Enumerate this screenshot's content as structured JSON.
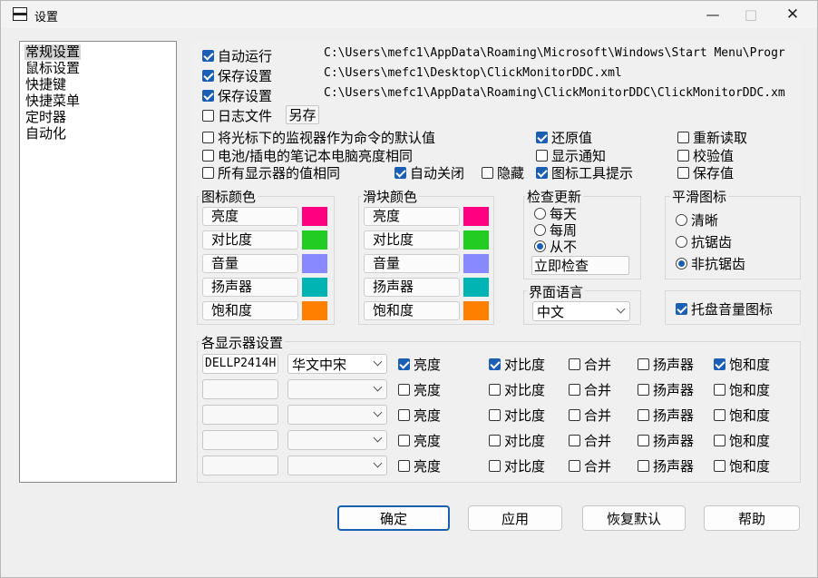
{
  "window": {
    "title": "设置"
  },
  "nav": {
    "items": [
      "常规设置",
      "鼠标设置",
      "快捷键",
      "快捷菜单",
      "定时器",
      "自动化"
    ],
    "selected": 0
  },
  "general": {
    "auto_run": {
      "label": "自动运行",
      "checked": true,
      "path": "C:\\Users\\mefc1\\AppData\\Roaming\\Microsoft\\Windows\\Start Menu\\Progr"
    },
    "save_settings1": {
      "label": "保存设置",
      "checked": true,
      "path": "C:\\Users\\mefc1\\Desktop\\ClickMonitorDDC.xml"
    },
    "save_settings2": {
      "label": "保存设置",
      "checked": true,
      "path": "C:\\Users\\mefc1\\AppData\\Roaming\\ClickMonitorDDC\\ClickMonitorDDC.xm"
    },
    "log_file": {
      "label": "日志文件",
      "checked": false,
      "save_as": "另存"
    }
  },
  "options": {
    "cursor_monitor_default": {
      "label": "将光标下的监视器作为命令的默认值",
      "checked": false
    },
    "battery_same": {
      "label": "电池/插电的笔记本电脑亮度相同",
      "checked": false
    },
    "all_same": {
      "label": "所有显示器的值相同",
      "checked": false
    },
    "auto_close": {
      "label": "自动关闭",
      "checked": true
    },
    "hide": {
      "label": "隐藏",
      "checked": false
    },
    "restore": {
      "label": "还原值",
      "checked": true
    },
    "show_notify": {
      "label": "显示通知",
      "checked": false
    },
    "icon_tooltip": {
      "label": "图标工具提示",
      "checked": true
    },
    "reread": {
      "label": "重新读取",
      "checked": false
    },
    "verify": {
      "label": "校验值",
      "checked": false
    },
    "save_value": {
      "label": "保存值",
      "checked": false
    }
  },
  "icon_colors": {
    "title": "图标颜色",
    "items": [
      {
        "label": "亮度",
        "color": "#ff0080"
      },
      {
        "label": "对比度",
        "color": "#22cc22"
      },
      {
        "label": "音量",
        "color": "#8888ff"
      },
      {
        "label": "扬声器",
        "color": "#00b4b4"
      },
      {
        "label": "饱和度",
        "color": "#ff8000"
      }
    ]
  },
  "slider_colors": {
    "title": "滑块颜色",
    "items": [
      {
        "label": "亮度",
        "color": "#ff0080"
      },
      {
        "label": "对比度",
        "color": "#22cc22"
      },
      {
        "label": "音量",
        "color": "#8888ff"
      },
      {
        "label": "扬声器",
        "color": "#00b4b4"
      },
      {
        "label": "饱和度",
        "color": "#ff8000"
      }
    ]
  },
  "update_check": {
    "title": "检查更新",
    "options": [
      "每天",
      "每周",
      "从不"
    ],
    "selected": 2,
    "check_now": "立即检查"
  },
  "language": {
    "title": "界面语言",
    "value": "中文"
  },
  "smooth_icon": {
    "title": "平滑图标",
    "options": [
      "清晰",
      "抗锯齿",
      "非抗锯齿"
    ],
    "selected": 2
  },
  "tray_volume": {
    "label": "托盘音量图标",
    "checked": true
  },
  "monitors": {
    "title": "各显示器设置",
    "labels": {
      "brightness": "亮度",
      "contrast": "对比度",
      "merge": "合并",
      "speaker": "扬声器",
      "saturation": "饱和度"
    },
    "rows": [
      {
        "name": "DELLP2414H",
        "font": "华文中宋",
        "brightness": true,
        "contrast": true,
        "merge": false,
        "speaker": false,
        "saturation": true
      },
      {
        "name": "",
        "font": "",
        "brightness": false,
        "contrast": false,
        "merge": false,
        "speaker": false,
        "saturation": false
      },
      {
        "name": "",
        "font": "",
        "brightness": false,
        "contrast": false,
        "merge": false,
        "speaker": false,
        "saturation": false
      },
      {
        "name": "",
        "font": "",
        "brightness": false,
        "contrast": false,
        "merge": false,
        "speaker": false,
        "saturation": false
      },
      {
        "name": "",
        "font": "",
        "brightness": false,
        "contrast": false,
        "merge": false,
        "speaker": false,
        "saturation": false
      }
    ]
  },
  "buttons": {
    "ok": "确定",
    "apply": "应用",
    "restore_default": "恢复默认",
    "help": "帮助"
  }
}
